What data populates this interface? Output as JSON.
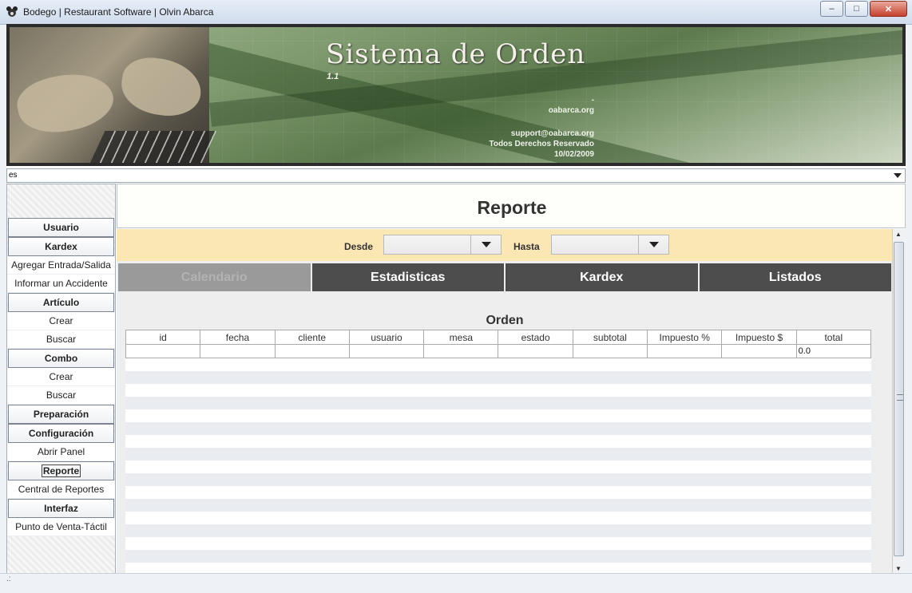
{
  "window": {
    "title": "Bodego | Restaurant Software | Olvin Abarca",
    "minimize": "–",
    "maximize": "□",
    "close": "✕"
  },
  "banner": {
    "title": "Sistema de Orden",
    "version": "1.1",
    "dash": "-",
    "site": "oabarca.org",
    "email": "support@oabarca.org",
    "rights": "Todos Derechos Reservado",
    "date": "10/02/2009"
  },
  "language": {
    "value": "es"
  },
  "sidebar": {
    "items": [
      {
        "label": "Usuario",
        "type": "header"
      },
      {
        "label": "Kardex",
        "type": "header"
      },
      {
        "label": "Agregar Entrada/Salida",
        "type": "link"
      },
      {
        "label": "Informar un Accidente",
        "type": "link"
      },
      {
        "label": "Artículo",
        "type": "header"
      },
      {
        "label": "Crear",
        "type": "link"
      },
      {
        "label": "Buscar",
        "type": "link"
      },
      {
        "label": "Combo",
        "type": "header"
      },
      {
        "label": "Crear",
        "type": "link"
      },
      {
        "label": "Buscar",
        "type": "link"
      },
      {
        "label": "Preparación",
        "type": "header"
      },
      {
        "label": "Configuración",
        "type": "header"
      },
      {
        "label": "Abrir Panel",
        "type": "link"
      },
      {
        "label": "Reporte",
        "type": "header"
      },
      {
        "label": "Central de Reportes",
        "type": "link"
      },
      {
        "label": "Interfaz",
        "type": "header"
      },
      {
        "label": "Punto de Venta-Táctil",
        "type": "link"
      }
    ]
  },
  "report": {
    "title": "Reporte",
    "filter": {
      "from_label": "Desde",
      "to_label": "Hasta"
    },
    "tabs": [
      "Calendario",
      "Estadisticas",
      "Kardex",
      "Listados"
    ],
    "selected_tab": 0,
    "grid_title": "Orden",
    "columns": [
      "id",
      "fecha",
      "cliente",
      "usuario",
      "mesa",
      "estado",
      "subtotal",
      "Impuesto %",
      "Impuesto $",
      "total"
    ],
    "rows": [
      [
        "",
        "",
        "",
        "",
        "",
        "",
        "",
        "",
        "",
        "0.0"
      ]
    ]
  },
  "status": {
    "text": ".:"
  },
  "colors": {
    "filter_bg": "#fbe7b3",
    "tab_bg": "#4d4d4d",
    "tab_selected": "#9a9a9a"
  }
}
